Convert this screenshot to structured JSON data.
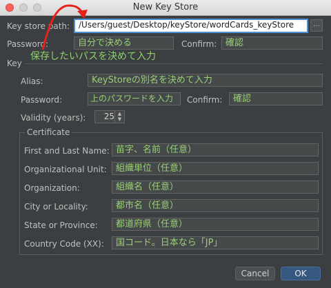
{
  "window": {
    "title": "New Key Store"
  },
  "keystore": {
    "path_label": "Key store path:",
    "path_value": "/Users/guest/Desktop/keyStore/wordCards_keyStore",
    "browse_label": "...",
    "password_label": "Password:",
    "password_value": "自分で決める",
    "confirm_label": "Confirm:",
    "confirm_value": "確認"
  },
  "annotation": {
    "text": "保存したいパスを決めて入力",
    "color": "#8fd16b",
    "arrow_color": "#e8201a"
  },
  "key": {
    "section_label": "Key",
    "alias_label": "Alias:",
    "alias_value": "KeyStoreの別名を決めて入力",
    "password_label": "Password:",
    "password_value": "上のパスワードを入力",
    "confirm_label": "Confirm:",
    "confirm_value": "確認",
    "validity_label": "Validity (years):",
    "validity_value": "25"
  },
  "certificate": {
    "title": "Certificate",
    "rows": [
      {
        "label": "First and Last Name:",
        "value": "苗字、名前（任意）"
      },
      {
        "label": "Organizational Unit:",
        "value": "組織単位（任意）"
      },
      {
        "label": "Organization:",
        "value": "組織名（任意）"
      },
      {
        "label": "City or Locality:",
        "value": "都市名（任意）"
      },
      {
        "label": "State or Province:",
        "value": "都道府県（任意）"
      },
      {
        "label": "Country Code (XX):",
        "value": "国コード。日本なら「JP」"
      }
    ]
  },
  "buttons": {
    "cancel": "Cancel",
    "ok": "OK"
  },
  "colors": {
    "background": "#3c3f41",
    "field_text": "#9ad077",
    "focus_border": "#4e90d6",
    "ok_button": "#365880"
  }
}
